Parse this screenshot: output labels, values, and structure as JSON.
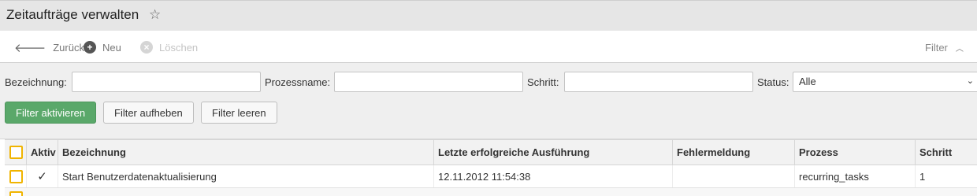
{
  "header": {
    "title": "Zeitaufträge verwalten",
    "favorite_icon": "star-icon"
  },
  "toolbar": {
    "back_label": "Zurück",
    "new_label": "Neu",
    "delete_label": "Löschen",
    "filter_label": "Filter"
  },
  "filters": {
    "name_label": "Bezeichnung:",
    "name_value": "",
    "process_label": "Prozessname:",
    "process_value": "",
    "step_label": "Schritt:",
    "step_value": "",
    "status_label": "Status:",
    "status_value": "Alle",
    "activate_label": "Filter aktivieren",
    "remove_label": "Filter aufheben",
    "clear_label": "Filter leeren"
  },
  "table": {
    "columns": [
      "Aktiv",
      "Bezeichnung",
      "Letzte erfolgreiche Ausführung",
      "Fehlermeldung",
      "Prozess",
      "Schritt"
    ],
    "rows": [
      {
        "active": "✓",
        "name": "Start Benutzerdatenaktualisierung",
        "last_run": "12.11.2012 11:54:38",
        "error": "",
        "process": "recurring_tasks",
        "step": "1"
      }
    ]
  },
  "colors": {
    "primary_button": "#5aa86a",
    "checkbox_border": "#f0b400"
  }
}
